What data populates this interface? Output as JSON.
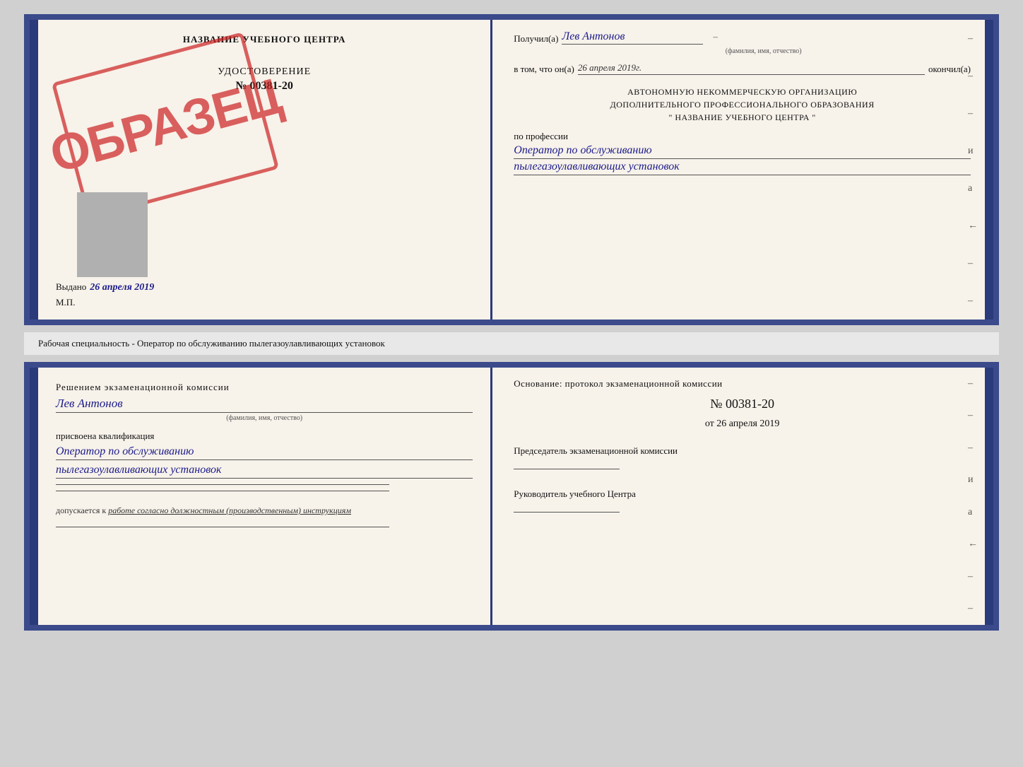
{
  "cert": {
    "title": "НАЗВАНИЕ УЧЕБНОГО ЦЕНТРА",
    "type_label": "УДОСТОВЕРЕНИЕ",
    "number": "№ 00381-20",
    "issued_label": "Выдано",
    "issued_date": "26 апреля 2019",
    "mp_label": "М.П.",
    "stamp_text": "ОБРАЗЕЦ",
    "received_label": "Получил(а)",
    "received_name": "Лев Антонов",
    "name_sublabel": "(фамилия, имя, отчество)",
    "date_label": "в том, что он(а)",
    "date_value": "26 апреля 2019г.",
    "completed_label": "окончил(а)",
    "org_line1": "АВТОНОМНУЮ НЕКОММЕРЧЕСКУЮ ОРГАНИЗАЦИЮ",
    "org_line2": "ДОПОЛНИТЕЛЬНОГО ПРОФЕССИОНАЛЬНОГО ОБРАЗОВАНИЯ",
    "org_line3": "\"   НАЗВАНИЕ УЧЕБНОГО ЦЕНТРА   \"",
    "profession_label": "по профессии",
    "profession_line1": "Оператор по обслуживанию",
    "profession_line2": "пылегазоулавливающих установок"
  },
  "middle": {
    "text": "Рабочая специальность - Оператор по обслуживанию пылегазоулавливающих установок"
  },
  "qual": {
    "decision_label": "Решением экзаменационной комиссии",
    "name_value": "Лев Антонов",
    "name_sublabel": "(фамилия, имя, отчество)",
    "assigned_label": "присвоена квалификация",
    "prof_line1": "Оператор по обслуживанию",
    "prof_line2": "пылегазоулавливающих установок",
    "allowed_label": "допускается к",
    "allowed_value": "работе согласно должностным (производственным) инструкциям",
    "basis_label": "Основание: протокол экзаменационной комиссии",
    "number_label": "№ 00381-20",
    "date_prefix": "от",
    "date_value": "26 апреля 2019",
    "chairman_label": "Председатель экзаменационной комиссии",
    "director_label": "Руководитель учебного Центра"
  },
  "dashes": [
    "-",
    "-",
    "-",
    "и",
    "а",
    "←",
    "-",
    "-"
  ]
}
